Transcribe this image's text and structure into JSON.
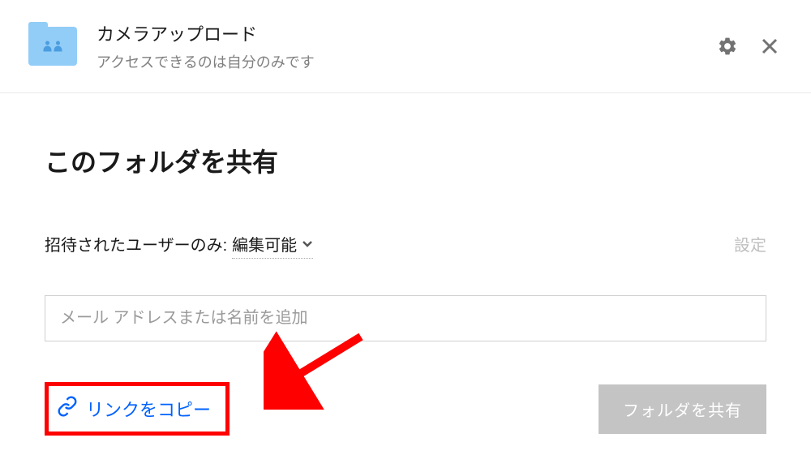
{
  "header": {
    "folder_title": "カメラアップロード",
    "access_text": "アクセスできるのは自分のみです"
  },
  "content": {
    "share_title": "このフォルダを共有",
    "permission_label": "招待されたユーザーのみ:",
    "permission_value": "編集可能",
    "settings_link": "設定",
    "email_placeholder": "メール アドレスまたは名前を追加",
    "copy_link": "リンクをコピー",
    "share_button": "フォルダを共有"
  }
}
